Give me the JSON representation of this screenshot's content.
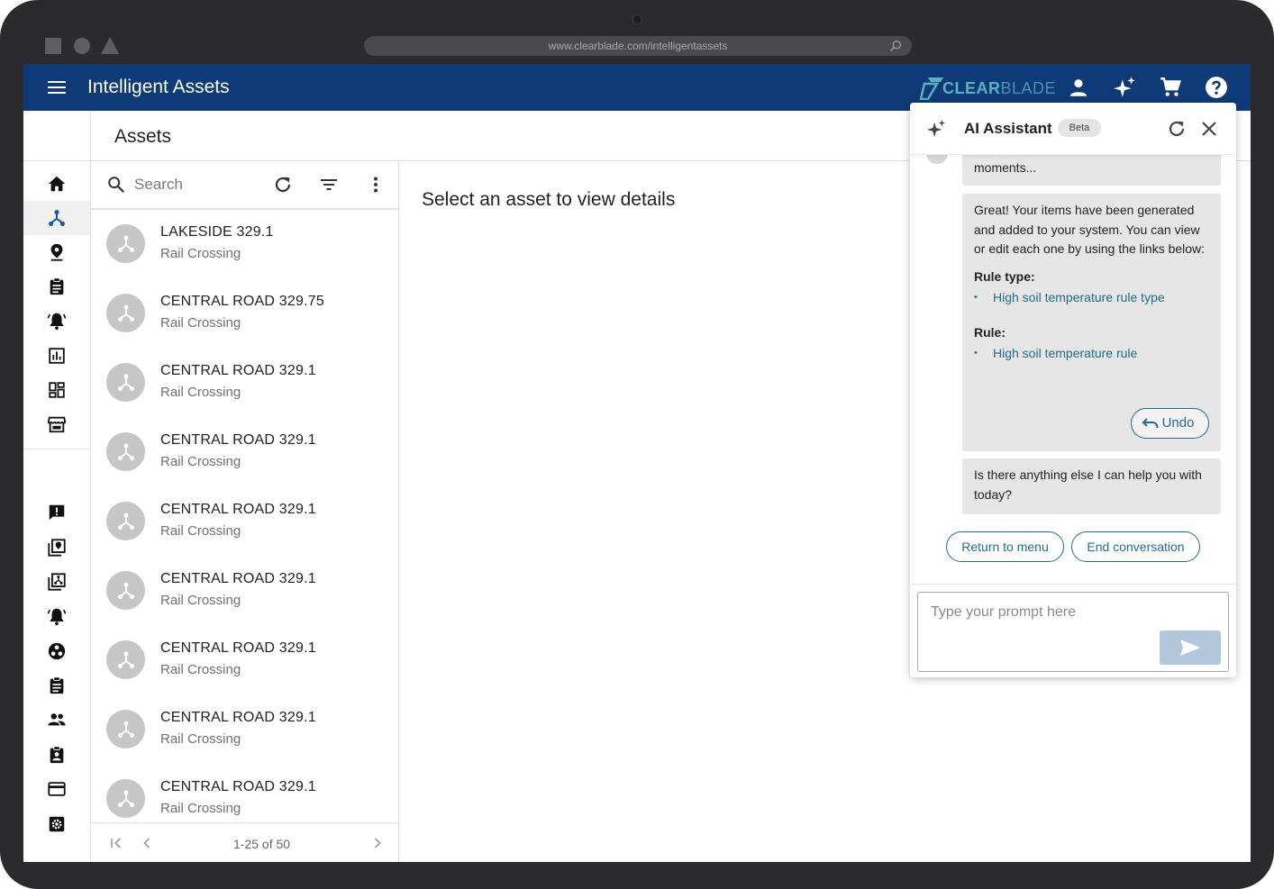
{
  "browser": {
    "url": "www.clearblade.com/intelligentassets"
  },
  "header": {
    "title": "Intelligent Assets",
    "logo_text_a": "CLEAR",
    "logo_text_b": "BLADE"
  },
  "page": {
    "title": "Assets",
    "empty_state": "Select an asset to view details"
  },
  "list": {
    "search_placeholder": "Search",
    "items": [
      {
        "name": "LAKESIDE 329.1",
        "type": "Rail Crossing"
      },
      {
        "name": "CENTRAL ROAD 329.75",
        "type": "Rail Crossing"
      },
      {
        "name": "CENTRAL ROAD 329.1",
        "type": "Rail Crossing"
      },
      {
        "name": "CENTRAL ROAD 329.1",
        "type": "Rail Crossing"
      },
      {
        "name": "CENTRAL ROAD 329.1",
        "type": "Rail Crossing"
      },
      {
        "name": "CENTRAL ROAD 329.1",
        "type": "Rail Crossing"
      },
      {
        "name": "CENTRAL ROAD 329.1",
        "type": "Rail Crossing"
      },
      {
        "name": "CENTRAL ROAD 329.1",
        "type": "Rail Crossing"
      },
      {
        "name": "CENTRAL ROAD 329.1",
        "type": "Rail Crossing"
      }
    ],
    "pagination": "1-25 of 50"
  },
  "assistant": {
    "title": "AI Assistant",
    "badge": "Beta",
    "msg_partial": "moments...",
    "msg_main": "Great! Your items have been generated and added to your system. You can view or edit each one by using the links below:",
    "rule_type_label": "Rule type:",
    "rule_type_link": "High soil temperature rule type",
    "rule_label": "Rule:",
    "rule_link": "High soil temperature rule",
    "undo_label": "Undo",
    "msg_followup": "Is there anything else I can help you with today?",
    "return_label": "Return to menu",
    "end_label": "End conversation",
    "prompt_placeholder": "Type your prompt here"
  },
  "colors": {
    "header_bg": "#0f3a78",
    "accent_link": "#236c8e",
    "send_disabled": "#b3c7dc"
  },
  "icons": {
    "rail": [
      "home-icon",
      "hierarchy-icon",
      "location-pin-icon",
      "clipboard-icon",
      "alarm-icon",
      "analytics-icon",
      "dashboard-icon",
      "storefront-icon",
      "alert-message-icon",
      "photo-location-icon",
      "photo-hierarchy-icon",
      "alarm-icon",
      "workspaces-icon",
      "clipboard-icon",
      "people-icon",
      "badge-icon",
      "card-icon",
      "settings-icon"
    ]
  }
}
